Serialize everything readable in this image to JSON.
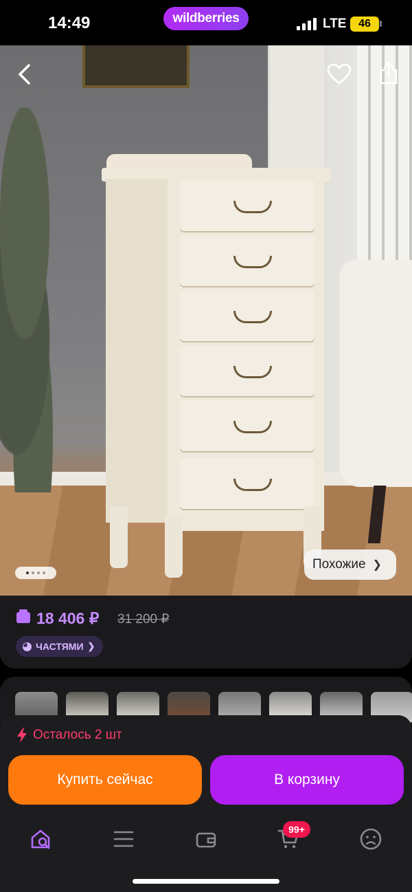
{
  "status_bar": {
    "time": "14:49",
    "brand": "wildberries",
    "network": "LTE",
    "battery": "46"
  },
  "product_image": {
    "similar_label": "Похожие",
    "gallery_count": 4
  },
  "price": {
    "current": "18 406 ₽",
    "old": "31 200 ₽",
    "installments_label": "ЧАСТЯМИ"
  },
  "purchase": {
    "stock_text": "Осталось 2 шт",
    "buy_now_label": "Купить сейчас",
    "add_to_cart_label": "В корзину"
  },
  "nav": {
    "cart_badge": "99+",
    "items": [
      "home-search",
      "catalog",
      "wallet",
      "cart",
      "profile"
    ]
  },
  "colors": {
    "accent_purple": "#b01ef2",
    "buy_now_orange": "#ff7a0e",
    "price_purple": "#c68bff",
    "stock_red": "#ff3b6b",
    "badge_red": "#f0164e"
  }
}
